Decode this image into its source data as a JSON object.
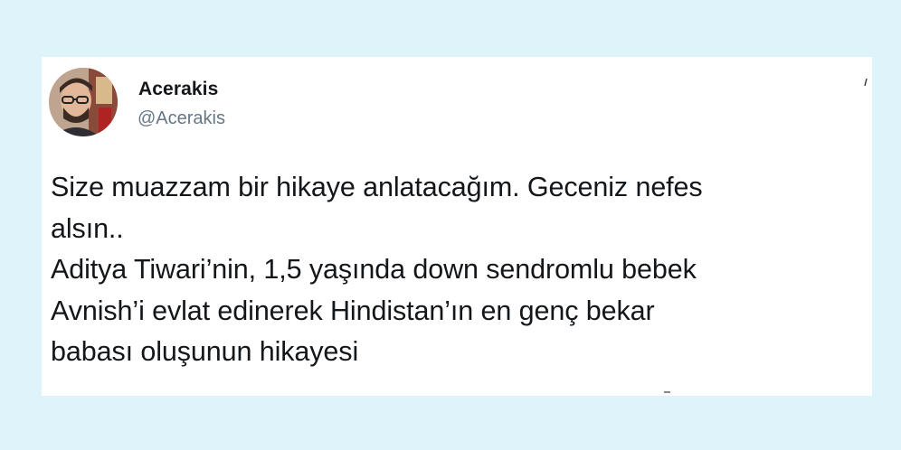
{
  "tweet": {
    "author": {
      "display_name": "Acerakis",
      "handle": "@Acerakis"
    },
    "text": "Size muazzam bir hikaye anlatacağım. Geceniz nefes\nalsın..\nAditya Tiwari’nin, 1,5 yaşında down sendromlu bebek\nAvnish’i evlat edinerek Hindistan’ın en genç bekar\nbabası oluşunun hikayesi"
  },
  "icons": {
    "avatar": "profile-photo",
    "menu": "caret-down-icon"
  },
  "colors": {
    "page_background": "#dff3fb",
    "card_background": "#ffffff",
    "text_primary": "#14171a",
    "text_secondary": "#657786"
  }
}
